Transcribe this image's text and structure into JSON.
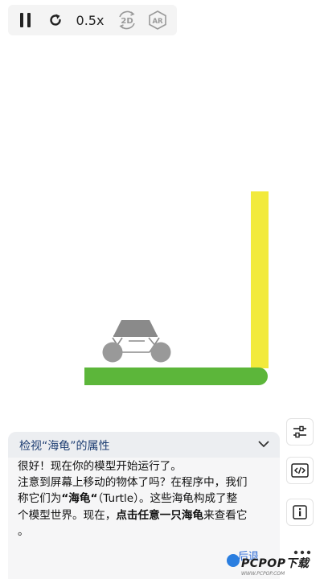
{
  "toolbar": {
    "speed_label": "0.5x",
    "mode_2d_label": "2D",
    "mode_ar_label": "AR",
    "icons": [
      "pause-icon",
      "restart-icon",
      "2d-mode-icon",
      "ar-mode-icon"
    ]
  },
  "scene": {
    "colors": {
      "ground": "#5cb63a",
      "pillar": "#f2ea3c",
      "car_body": "#8a8a8a",
      "wheel": "#9a9a9a"
    }
  },
  "panel": {
    "title": "检视“海龟”的属性",
    "line1": "很好！现在你的模型开始运行了。",
    "line2a": "注意到屏幕上移动的物体了吗？在程序中，我们",
    "line3a": "称它们为",
    "line3b": "“海龟“",
    "line3c": "（Turtle）。这些海龟构成了整",
    "line4a": "个模型世界。现在，",
    "line4b": "点击任意一只海龟",
    "line4c": "来查看它",
    "line5": "。",
    "back_label": "后退"
  },
  "side_buttons": [
    "settings-sliders-icon",
    "code-icon",
    "info-icon"
  ],
  "watermark": {
    "text": "PCPOP下载",
    "sub": "WWW.PCPOP.COM"
  }
}
